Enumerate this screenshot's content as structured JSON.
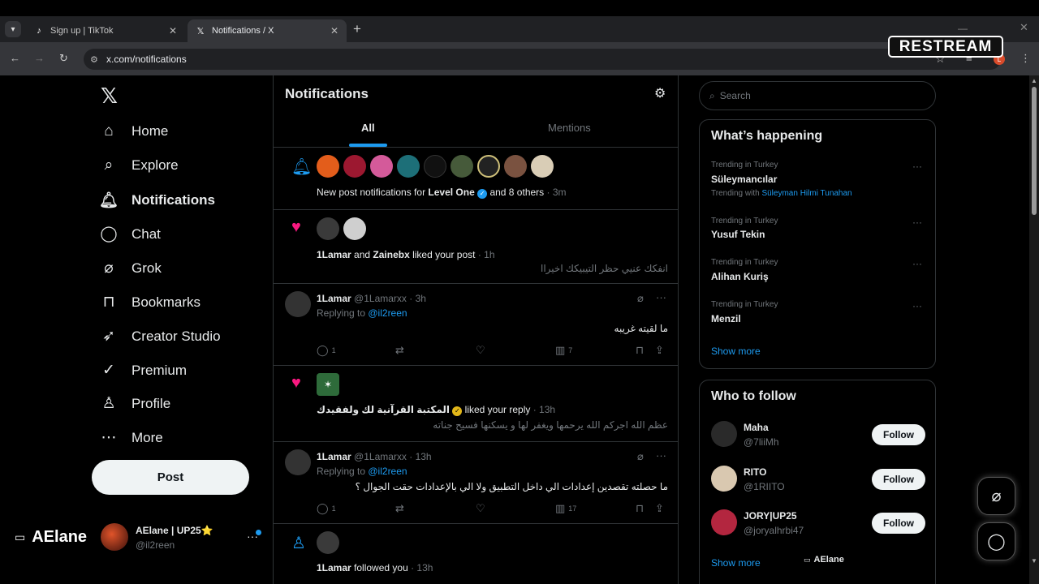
{
  "browser": {
    "tabs": [
      {
        "title": "Sign up | TikTok",
        "icon": "tiktok-icon"
      },
      {
        "title": "Notifications / X",
        "icon": "x-logo-icon"
      }
    ],
    "url": "x.com/notifications",
    "restream_badge": "RESTREAM"
  },
  "sidebar": {
    "items": [
      {
        "label": "Home",
        "icon": "home-icon"
      },
      {
        "label": "Explore",
        "icon": "search-icon"
      },
      {
        "label": "Notifications",
        "icon": "bell-icon"
      },
      {
        "label": "Chat",
        "icon": "chat-icon"
      },
      {
        "label": "Grok",
        "icon": "grok-icon"
      },
      {
        "label": "Bookmarks",
        "icon": "bookmark-icon"
      },
      {
        "label": "Creator Studio",
        "icon": "rocket-icon"
      },
      {
        "label": "Premium",
        "icon": "verified-icon"
      },
      {
        "label": "Profile",
        "icon": "person-icon"
      },
      {
        "label": "More",
        "icon": "more-circle-icon"
      }
    ],
    "post_label": "Post",
    "stream_label": "AElane",
    "account": {
      "name": "AElane | UP25⭐",
      "handle": "@il2reen"
    }
  },
  "main": {
    "title": "Notifications",
    "tabs": [
      "All",
      "Mentions"
    ],
    "n1": {
      "pre": "New post notifications for ",
      "bold": "Level One",
      "post": " and 8 others",
      "time": " · 3m"
    },
    "n2": {
      "bold1": "1Lamar",
      "mid": " and ",
      "bold2": "Zainebx",
      "post": " liked your post",
      "time": " · 1h",
      "quote": "انفكك عنيي حظر التيبيكك اخيراا"
    },
    "r1": {
      "name": "1Lamar",
      "handle": "@1Lamarxx · 3h",
      "replying": "Replying to ",
      "to": "@il2reen",
      "text": "ما لقيته غريبه",
      "replies": "1",
      "views": "7"
    },
    "n3": {
      "bold": "المكتبة القرآنية لك ولفقيدك",
      "post": " liked your reply",
      "time": " · 13h",
      "quote": "عظم الله اجركم الله يرحمها ويغفر لها و يسكنها فسيح جناته"
    },
    "r2": {
      "name": "1Lamar",
      "handle": "@1Lamarxx · 13h",
      "replying": "Replying to ",
      "to": "@il2reen",
      "text": "ما حصلته تقصدين إعدادات الي داخل  التطبيق ولا الي بالإعدادات حقت الجوال ؟",
      "replies": "1",
      "views": "17"
    },
    "n4": {
      "bold": "1Lamar",
      "post": " followed you",
      "time": " · 13h"
    }
  },
  "right": {
    "search_placeholder": "Search",
    "trending_title": "What’s happening",
    "trends": [
      {
        "meta": "Trending in Turkey",
        "name": "Süleymancılar",
        "with_label": "Trending with",
        "with_value": "Süleyman Hilmi Tunahan"
      },
      {
        "meta": "Trending in Turkey",
        "name": "Yusuf Tekin"
      },
      {
        "meta": "Trending in Turkey",
        "name": "Alihan Kuriş"
      },
      {
        "meta": "Trending in Turkey",
        "name": "Menzil"
      }
    ],
    "show_more": "Show more",
    "wtf_title": "Who to follow",
    "follow": [
      {
        "name": "Maha",
        "handle": "@7liiMh"
      },
      {
        "name": "RITO",
        "handle": "@1RIITO"
      },
      {
        "name": "JORY|UP25",
        "handle": "@joryalhrbi47"
      }
    ],
    "follow_label": "Follow",
    "stream_overlay": "AElane"
  }
}
